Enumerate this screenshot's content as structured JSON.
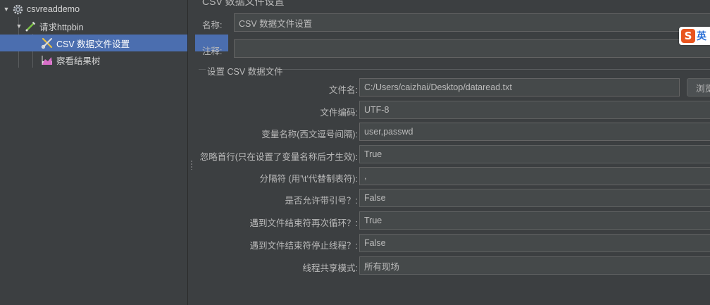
{
  "tree": {
    "items": [
      {
        "label": "csvreaddemo",
        "icon": "gear-icon",
        "expanded": true
      },
      {
        "label": "请求httpbin",
        "icon": "pipette-icon",
        "expanded": true
      },
      {
        "label": "CSV 数据文件设置",
        "icon": "scissors-config-icon",
        "selected": true
      },
      {
        "label": "察看结果树",
        "icon": "chart-icon"
      }
    ]
  },
  "form": {
    "panel_title": "CSV 数据文件设置",
    "name_label": "名称:",
    "name_value": "CSV 数据文件设置",
    "comment_label": "注释:",
    "comment_value": "",
    "group_title": "设置 CSV 数据文件",
    "fields": [
      {
        "label": "文件名:",
        "value": "C:/Users/caizhai/Desktop/dataread.txt"
      },
      {
        "label": "文件编码:",
        "value": "UTF-8"
      },
      {
        "label": "变量名称(西文逗号间隔):",
        "value": "user,passwd"
      },
      {
        "label": "忽略首行(只在设置了变量名称后才生效):",
        "value": "True"
      },
      {
        "label": "分隔符 (用'\\t'代替制表符):",
        "value": ","
      },
      {
        "label": "是否允许带引号？:",
        "value": "False"
      },
      {
        "label": "遇到文件结束符再次循环？:",
        "value": "True"
      },
      {
        "label": "遇到文件结束符停止线程？:",
        "value": "False"
      },
      {
        "label": "线程共享模式:",
        "value": "所有现场"
      }
    ],
    "browse_label": "浏览..."
  },
  "ime": {
    "logo": "S",
    "text": "英"
  },
  "colors": {
    "background": "#3c3f41",
    "field_bg": "#45494a",
    "selection": "#4b6eaf",
    "text": "#bbbbbb"
  }
}
